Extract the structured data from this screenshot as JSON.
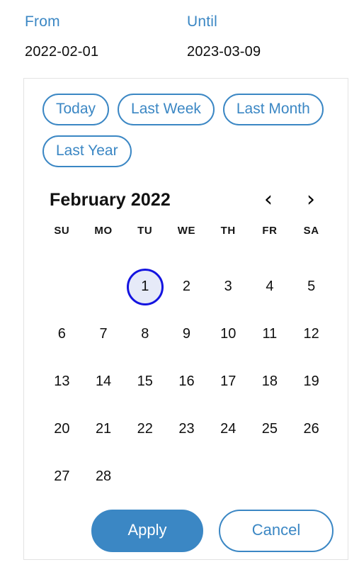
{
  "range": {
    "from": {
      "label": "From",
      "value": "2022-02-01"
    },
    "until": {
      "label": "Until",
      "value": "2023-03-09"
    }
  },
  "presets": [
    {
      "label": "Today"
    },
    {
      "label": "Last Week"
    },
    {
      "label": "Last Month"
    },
    {
      "label": "Last Year"
    }
  ],
  "calendar": {
    "month_title": "February 2022",
    "prev_icon": "‹",
    "next_icon": "›",
    "weekdays": [
      "SU",
      "MO",
      "TU",
      "WE",
      "TH",
      "FR",
      "SA"
    ],
    "selected_day": 1,
    "weeks": [
      [
        "",
        "",
        "1",
        "2",
        "3",
        "4",
        "5"
      ],
      [
        "6",
        "7",
        "8",
        "9",
        "10",
        "11",
        "12"
      ],
      [
        "13",
        "14",
        "15",
        "16",
        "17",
        "18",
        "19"
      ],
      [
        "20",
        "21",
        "22",
        "23",
        "24",
        "25",
        "26"
      ],
      [
        "27",
        "28",
        "",
        "",
        "",
        "",
        ""
      ]
    ]
  },
  "actions": {
    "apply": "Apply",
    "cancel": "Cancel"
  },
  "colors": {
    "accent": "#3b87c4",
    "selected_ring": "#1414e0",
    "selected_fill": "#e6eaf8",
    "panel_border": "#e3e3e3",
    "text": "#0f0f0f"
  }
}
